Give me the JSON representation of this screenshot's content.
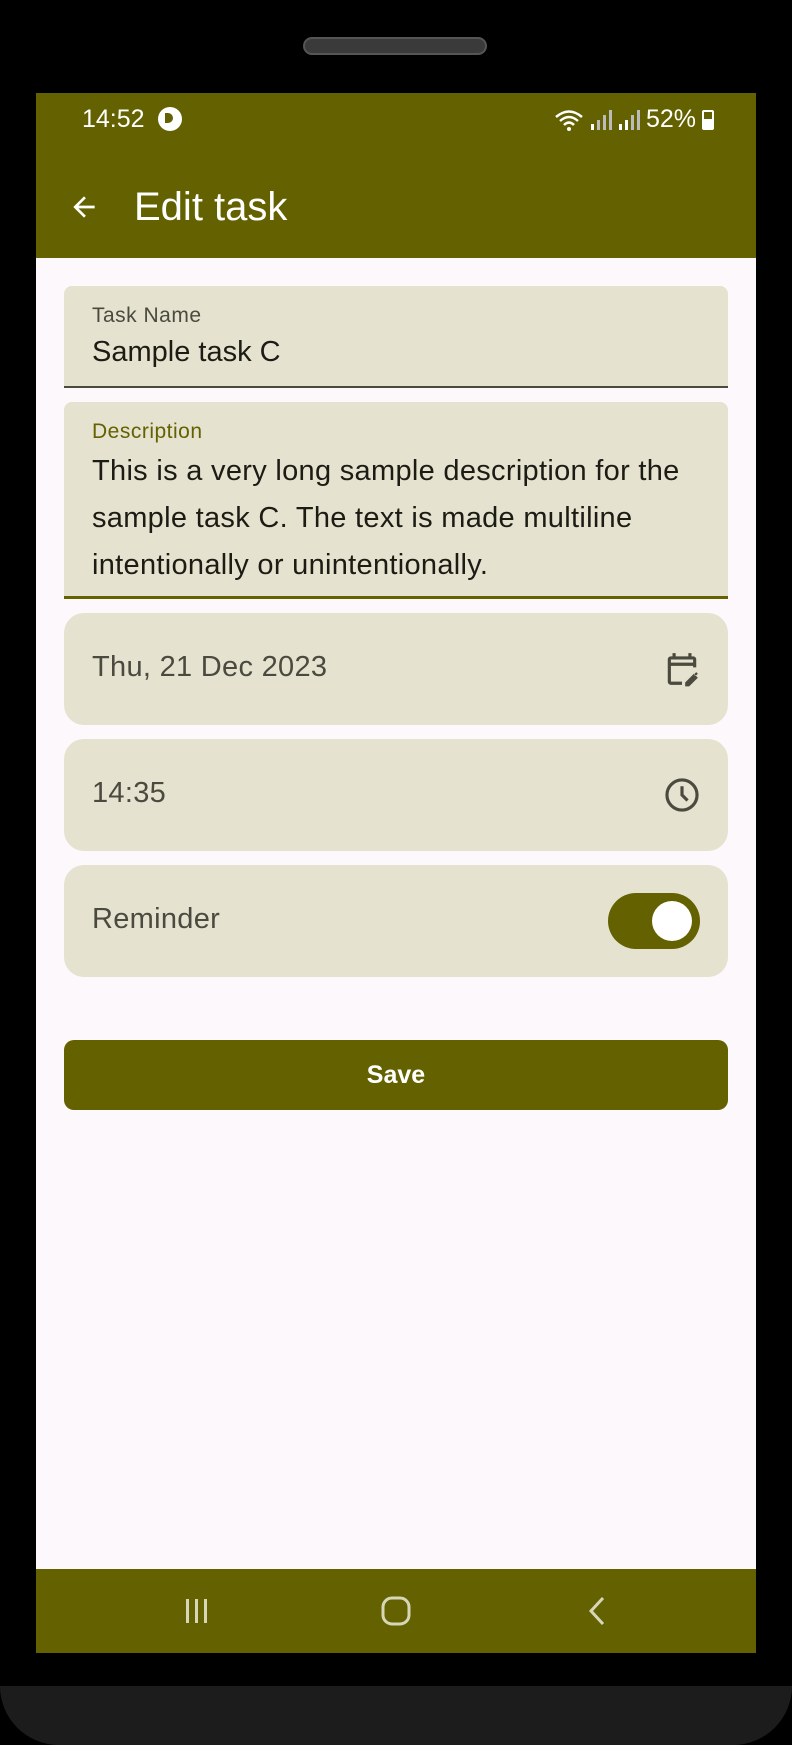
{
  "status_bar": {
    "time": "14:52",
    "battery": "52%"
  },
  "app_bar": {
    "title": "Edit task",
    "back_icon": "arrow-back-icon"
  },
  "form": {
    "task_name": {
      "label": "Task Name",
      "value": "Sample task C"
    },
    "description": {
      "label": "Description",
      "value": "This is a very long sample description for the sample task C. The text is made multiline intentionally or unintentionally."
    },
    "date": {
      "value": "Thu, 21 Dec 2023",
      "icon": "calendar-edit-icon"
    },
    "time": {
      "value": "14:35",
      "icon": "clock-icon"
    },
    "reminder": {
      "label": "Reminder",
      "enabled": true
    },
    "save_label": "Save"
  },
  "nav_bar": {
    "icons": [
      "recents-icon",
      "home-icon",
      "back-icon"
    ]
  },
  "colors": {
    "primary": "#636100",
    "surface_variant": "#e5e2cf",
    "background": "#fdf8fc"
  }
}
